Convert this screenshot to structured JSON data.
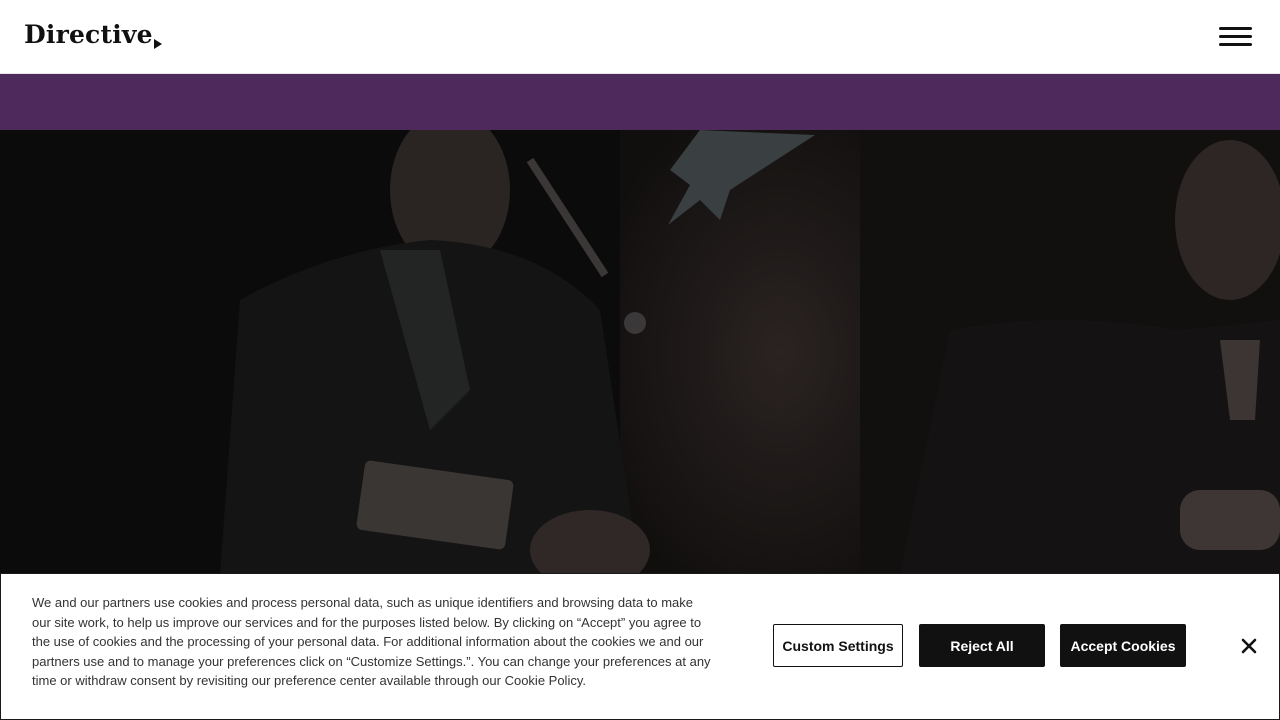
{
  "header": {
    "logo_text": "Directive",
    "menu_icon": "hamburger-menu-icon"
  },
  "banner": {
    "color": "#4e2a5c"
  },
  "hero": {
    "description": "Dimmed video frame with two people seated on a stage"
  },
  "cookie_banner": {
    "text": "We and our partners use cookies and process personal data, such as unique identifiers and browsing data to make our site work, to help us improve our services and for the purposes listed below. By clicking on “Accept” you agree to the use of cookies and the processing of your personal data. For additional information about the cookies we and our partners use and to manage your preferences click on “Customize Settings.”. You can change your preferences at any time or withdraw consent by revisiting our preference center available through our ",
    "policy_link": "Cookie Policy",
    "after_link": ".",
    "buttons": {
      "custom": "Custom Settings",
      "reject": "Reject All",
      "accept": "Accept Cookies"
    },
    "close_icon": "close-icon"
  }
}
